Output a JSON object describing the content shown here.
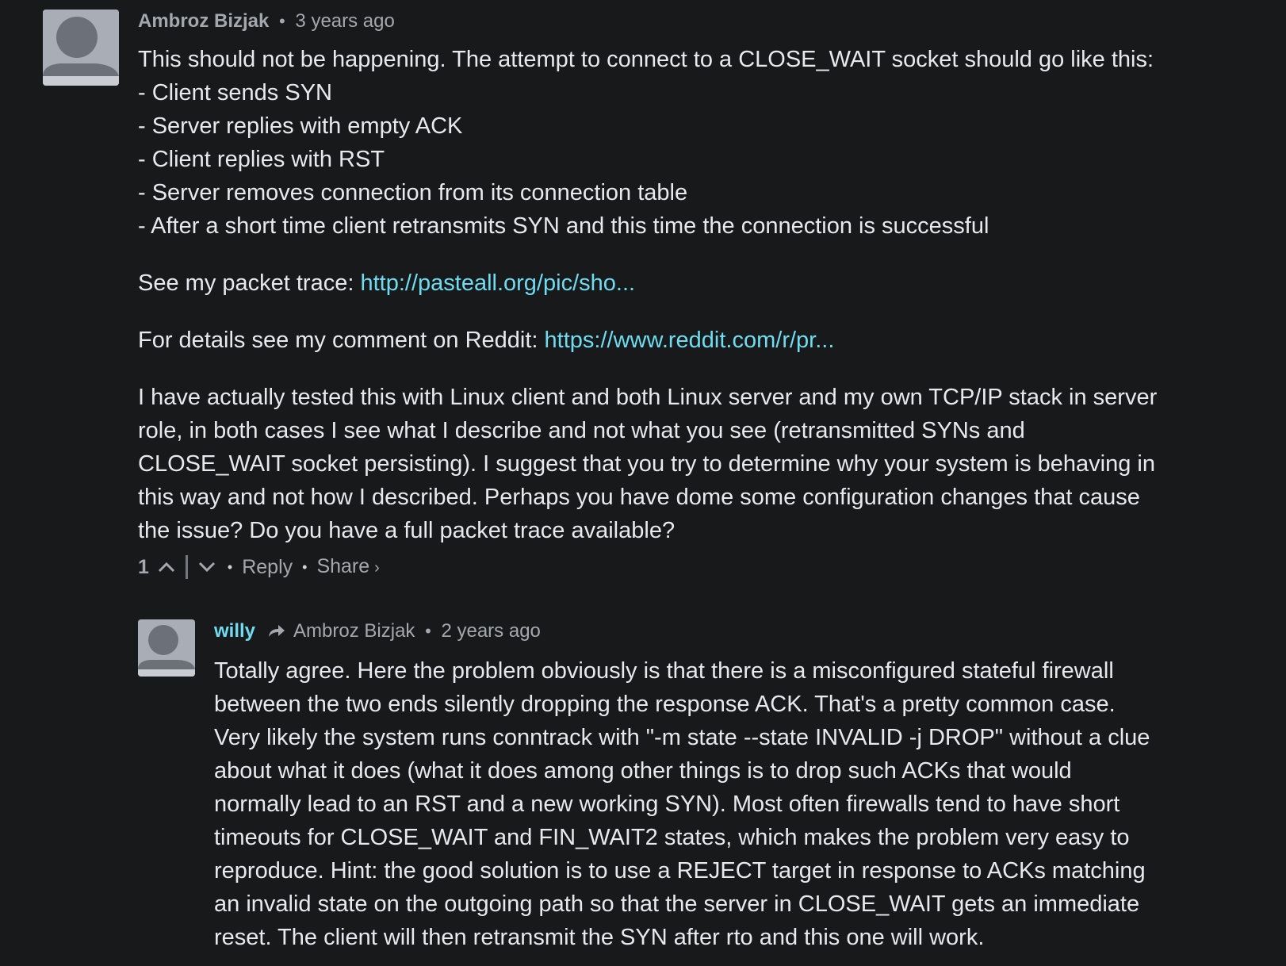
{
  "comments": [
    {
      "author": "Ambroz Bizjak",
      "time": "3 years ago",
      "body": {
        "lines": [
          "This should not be happening. The attempt to connect to a CLOSE_WAIT socket should go like this:",
          "- Client sends SYN",
          "- Server replies with empty ACK",
          "- Client replies with RST",
          "- Server removes connection from its connection table",
          "- After a short time client retransmits SYN and this time the connection is successful"
        ],
        "trace_prefix": "See my packet trace: ",
        "trace_link": "http://pasteall.org/pic/sho...",
        "reddit_prefix": "For details see my comment on Reddit: ",
        "reddit_link": "https://www.reddit.com/r/pr...",
        "final_lines": [
          "I have actually tested this with Linux client and both Linux server and my own TCP/IP stack in server",
          "role, in both cases I see what I describe and not what you see (retransmitted SYNs and",
          "CLOSE_WAIT socket persisting). I suggest that you try to determine why your system is behaving in",
          "this way and not how I described. Perhaps you have dome some configuration changes that cause",
          "the issue? Do you have a full packet trace available?"
        ]
      },
      "votes": "1",
      "reply_label": "Reply",
      "share_label": "Share",
      "share_chevron": "›",
      "header_dot": "•",
      "footer_dot": "•"
    },
    {
      "author": "willy",
      "reply_to": "Ambroz Bizjak",
      "time": "2 years ago",
      "header_dot": "•",
      "body": {
        "lines": [
          "Totally agree. Here the problem obviously is that there is a misconfigured stateful firewall",
          "between the two ends silently dropping the response ACK. That's a pretty common case.",
          "Very likely the system runs conntrack with \"-m state --state INVALID -j DROP\" without a clue",
          "about what it does (what it does among other things is to drop such ACKs that would",
          "normally lead to an RST and a new working SYN). Most often firewalls tend to have short",
          "timeouts for CLOSE_WAIT and FIN_WAIT2 states, which makes the problem very easy to",
          "reproduce. Hint: the good solution is to use a REJECT target in response to ACKs matching",
          "an invalid state on the outgoing path so that the server in CLOSE_WAIT gets an immediate",
          "reset. The client will then retransmit the SYN after rto and this one will work."
        ]
      }
    }
  ],
  "colors": {
    "background": "#18191b",
    "text": "#e7e9ee",
    "muted": "#a4a7ad",
    "link": "#6fdcf0",
    "avatar": "#a9adb5"
  },
  "icons": {
    "avatar": "user-silhouette-icon",
    "upvote": "chevron-up-icon",
    "downvote": "chevron-down-icon",
    "reply_arrow": "reply-arrow-icon"
  }
}
